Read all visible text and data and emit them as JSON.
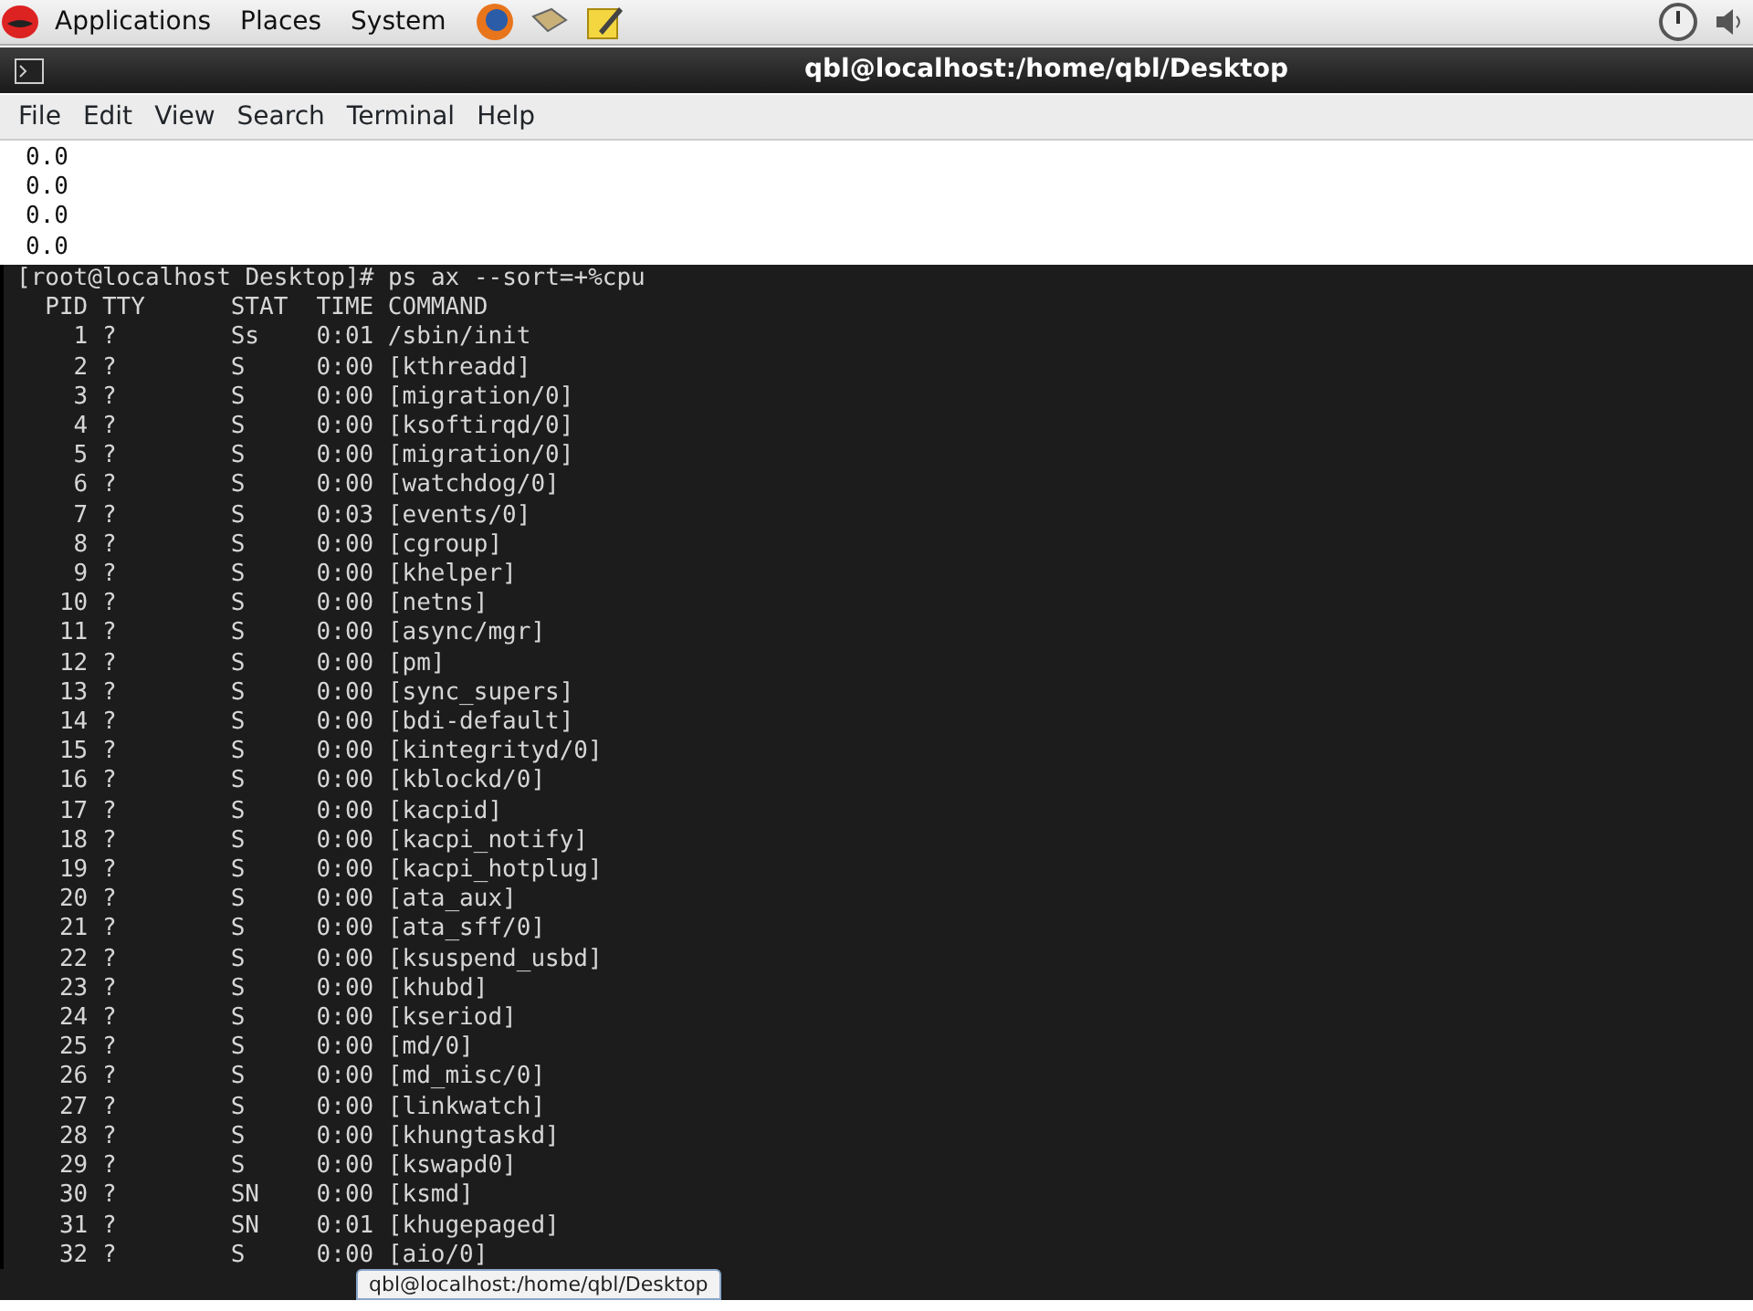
{
  "top_panel": {
    "menus": [
      "Applications",
      "Places",
      "System"
    ]
  },
  "window": {
    "title": "qbl@localhost:/home/qbl/Desktop"
  },
  "menu_bar": [
    "File",
    "Edit",
    "View",
    "Search",
    "Terminal",
    "Help"
  ],
  "scrollback_lines": [
    "0.0",
    "0.0",
    "0.0",
    "0.0"
  ],
  "prompt": "[root@localhost Desktop]# ps ax --sort=+%cpu",
  "table": {
    "columns": [
      "PID",
      "TTY",
      "STAT",
      "TIME",
      "COMMAND"
    ],
    "rows": [
      [
        "1",
        "?",
        "Ss",
        "0:01",
        "/sbin/init"
      ],
      [
        "2",
        "?",
        "S",
        "0:00",
        "[kthreadd]"
      ],
      [
        "3",
        "?",
        "S",
        "0:00",
        "[migration/0]"
      ],
      [
        "4",
        "?",
        "S",
        "0:00",
        "[ksoftirqd/0]"
      ],
      [
        "5",
        "?",
        "S",
        "0:00",
        "[migration/0]"
      ],
      [
        "6",
        "?",
        "S",
        "0:00",
        "[watchdog/0]"
      ],
      [
        "7",
        "?",
        "S",
        "0:03",
        "[events/0]"
      ],
      [
        "8",
        "?",
        "S",
        "0:00",
        "[cgroup]"
      ],
      [
        "9",
        "?",
        "S",
        "0:00",
        "[khelper]"
      ],
      [
        "10",
        "?",
        "S",
        "0:00",
        "[netns]"
      ],
      [
        "11",
        "?",
        "S",
        "0:00",
        "[async/mgr]"
      ],
      [
        "12",
        "?",
        "S",
        "0:00",
        "[pm]"
      ],
      [
        "13",
        "?",
        "S",
        "0:00",
        "[sync_supers]"
      ],
      [
        "14",
        "?",
        "S",
        "0:00",
        "[bdi-default]"
      ],
      [
        "15",
        "?",
        "S",
        "0:00",
        "[kintegrityd/0]"
      ],
      [
        "16",
        "?",
        "S",
        "0:00",
        "[kblockd/0]"
      ],
      [
        "17",
        "?",
        "S",
        "0:00",
        "[kacpid]"
      ],
      [
        "18",
        "?",
        "S",
        "0:00",
        "[kacpi_notify]"
      ],
      [
        "19",
        "?",
        "S",
        "0:00",
        "[kacpi_hotplug]"
      ],
      [
        "20",
        "?",
        "S",
        "0:00",
        "[ata_aux]"
      ],
      [
        "21",
        "?",
        "S",
        "0:00",
        "[ata_sff/0]"
      ],
      [
        "22",
        "?",
        "S",
        "0:00",
        "[ksuspend_usbd]"
      ],
      [
        "23",
        "?",
        "S",
        "0:00",
        "[khubd]"
      ],
      [
        "24",
        "?",
        "S",
        "0:00",
        "[kseriod]"
      ],
      [
        "25",
        "?",
        "S",
        "0:00",
        "[md/0]"
      ],
      [
        "26",
        "?",
        "S",
        "0:00",
        "[md_misc/0]"
      ],
      [
        "27",
        "?",
        "S",
        "0:00",
        "[linkwatch]"
      ],
      [
        "28",
        "?",
        "S",
        "0:00",
        "[khungtaskd]"
      ],
      [
        "29",
        "?",
        "S",
        "0:00",
        "[kswapd0]"
      ],
      [
        "30",
        "?",
        "SN",
        "0:00",
        "[ksmd]"
      ],
      [
        "31",
        "?",
        "SN",
        "0:01",
        "[khugepaged]"
      ],
      [
        "32",
        "?",
        "S",
        "0:00",
        "[aio/0]"
      ]
    ]
  },
  "taskbar": {
    "window_button": "qbl@localhost:/home/qbl/Desktop"
  }
}
